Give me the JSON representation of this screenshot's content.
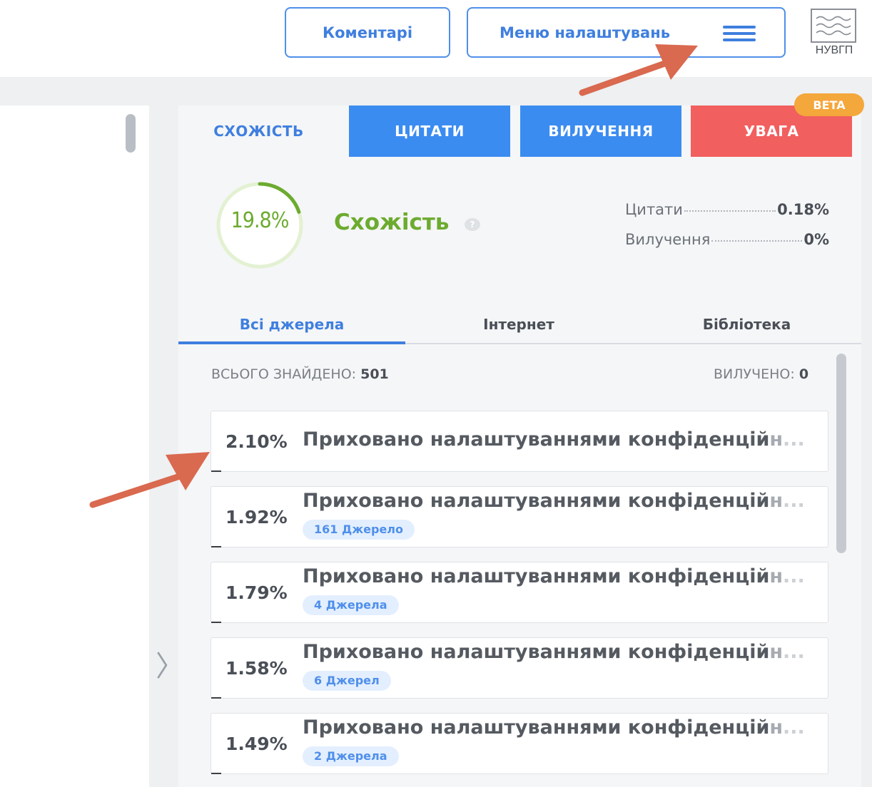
{
  "header": {
    "comments_label": "Коментарі",
    "settings_menu_label": "Меню налаштувань",
    "logo_text": "НУВГП"
  },
  "tabs": [
    {
      "label": "СХОЖІСТЬ"
    },
    {
      "label": "ЦИТАТИ"
    },
    {
      "label": "ВИЛУЧЕННЯ"
    },
    {
      "label": "УВАГА"
    }
  ],
  "beta_badge": "BETA",
  "summary": {
    "similarity_value": "19.8%",
    "similarity_fraction": 0.198,
    "similarity_label": "Схожість",
    "help": "?",
    "quotes_label": "Цитати",
    "quotes_value": "0.18%",
    "exclusions_label": "Вилучення",
    "exclusions_value": "0%"
  },
  "source_tabs": [
    {
      "label": "Всі джерела"
    },
    {
      "label": "Інтернет"
    },
    {
      "label": "Бібліотека"
    }
  ],
  "list": {
    "found_label": "ВСЬОГО ЗНАЙДЕНО:",
    "found_count": "501",
    "excluded_label": "ВИЛУЧЕНО:",
    "excluded_count": "0"
  },
  "sources": [
    {
      "percent": "2.10%",
      "title_main": "Приховано налаштуваннями конфіденцій",
      "title_fade": "н",
      "title_fade2": "...",
      "badge": ""
    },
    {
      "percent": "1.92%",
      "title_main": "Приховано налаштуваннями конфіденцій",
      "title_fade": "н",
      "title_fade2": "...",
      "badge": "161 Джерело"
    },
    {
      "percent": "1.79%",
      "title_main": "Приховано налаштуваннями конфіденцій",
      "title_fade": "н",
      "title_fade2": "...",
      "badge": "4 Джерела"
    },
    {
      "percent": "1.58%",
      "title_main": "Приховано налаштуваннями конфіденцій",
      "title_fade": "н",
      "title_fade2": "...",
      "badge": "6 Джерел"
    },
    {
      "percent": "1.49%",
      "title_main": "Приховано налаштуваннями конфіденцій",
      "title_fade": "н",
      "title_fade2": "...",
      "badge": "2 Джерела"
    }
  ],
  "colors": {
    "accent_blue": "#3b8cf1",
    "warning_red": "#f25f5f",
    "beta_orange": "#f4a73a",
    "similarity_green": "#6cab2f",
    "annotation_arrow": "#d9694f"
  },
  "icons": [
    "menu-icon",
    "logo-icon",
    "help-icon",
    "chevron-right-icon"
  ]
}
